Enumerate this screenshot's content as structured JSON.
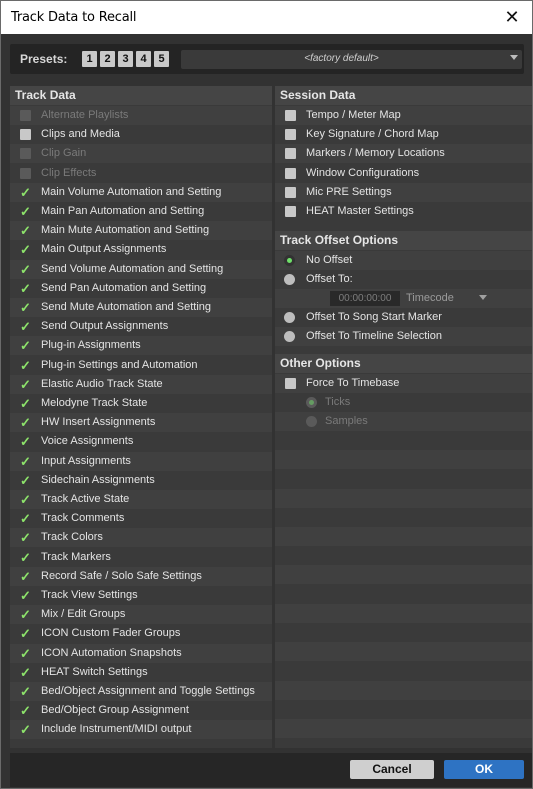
{
  "window": {
    "title": "Track Data to Recall",
    "close_glyph": "✕"
  },
  "presets": {
    "label": "Presets:",
    "buttons": [
      "1",
      "2",
      "3",
      "4",
      "5"
    ],
    "selected": "<factory default>"
  },
  "track_data": {
    "header": "Track Data",
    "items": [
      {
        "label": "Alternate Playlists",
        "state": "disabled"
      },
      {
        "label": "Clips and Media",
        "state": "unchecked"
      },
      {
        "label": "Clip Gain",
        "state": "disabled"
      },
      {
        "label": "Clip Effects",
        "state": "disabled"
      },
      {
        "label": "Main Volume Automation and Setting",
        "state": "checked"
      },
      {
        "label": "Main Pan Automation and Setting",
        "state": "checked"
      },
      {
        "label": "Main Mute Automation and Setting",
        "state": "checked"
      },
      {
        "label": "Main Output Assignments",
        "state": "checked"
      },
      {
        "label": "Send Volume Automation and Setting",
        "state": "checked"
      },
      {
        "label": "Send Pan Automation and Setting",
        "state": "checked"
      },
      {
        "label": "Send Mute Automation and Setting",
        "state": "checked"
      },
      {
        "label": "Send Output Assignments",
        "state": "checked"
      },
      {
        "label": "Plug-in Assignments",
        "state": "checked"
      },
      {
        "label": "Plug-in Settings and Automation",
        "state": "checked"
      },
      {
        "label": "Elastic Audio Track State",
        "state": "checked"
      },
      {
        "label": "Melodyne Track State",
        "state": "checked"
      },
      {
        "label": "HW Insert Assignments",
        "state": "checked"
      },
      {
        "label": "Voice Assignments",
        "state": "checked"
      },
      {
        "label": "Input Assignments",
        "state": "checked"
      },
      {
        "label": "Sidechain Assignments",
        "state": "checked"
      },
      {
        "label": "Track Active State",
        "state": "checked"
      },
      {
        "label": "Track Comments",
        "state": "checked"
      },
      {
        "label": "Track Colors",
        "state": "checked"
      },
      {
        "label": "Track Markers",
        "state": "checked"
      },
      {
        "label": "Record Safe / Solo Safe Settings",
        "state": "checked"
      },
      {
        "label": "Track View Settings",
        "state": "checked"
      },
      {
        "label": "Mix / Edit Groups",
        "state": "checked"
      },
      {
        "label": "ICON Custom Fader Groups",
        "state": "checked"
      },
      {
        "label": "ICON Automation Snapshots",
        "state": "checked"
      },
      {
        "label": "HEAT Switch Settings",
        "state": "checked"
      },
      {
        "label": "Bed/Object Assignment and Toggle Settings",
        "state": "checked"
      },
      {
        "label": "Bed/Object Group Assignment",
        "state": "checked"
      },
      {
        "label": "Include Instrument/MIDI output",
        "state": "checked"
      }
    ]
  },
  "session_data": {
    "header": "Session Data",
    "items": [
      {
        "label": "Tempo / Meter Map",
        "state": "unchecked"
      },
      {
        "label": "Key Signature / Chord Map",
        "state": "unchecked"
      },
      {
        "label": "Markers / Memory Locations",
        "state": "unchecked"
      },
      {
        "label": "Window Configurations",
        "state": "unchecked"
      },
      {
        "label": "Mic PRE Settings",
        "state": "unchecked"
      },
      {
        "label": "HEAT Master Settings",
        "state": "unchecked"
      }
    ]
  },
  "track_offset": {
    "header": "Track Offset Options",
    "no_offset": "No Offset",
    "offset_to": "Offset To:",
    "timecode_value": "00:00:00:00",
    "timecode_format": "Timecode",
    "song_start": "Offset To Song Start Marker",
    "timeline_selection": "Offset To Timeline Selection",
    "selected": "No Offset"
  },
  "other_options": {
    "header": "Other Options",
    "force_timebase": "Force To Timebase",
    "ticks": "Ticks",
    "samples": "Samples",
    "selected_timebase": "Ticks"
  },
  "footer": {
    "cancel": "Cancel",
    "ok": "OK"
  },
  "colors": {
    "check_green": "#8de36b",
    "ok_blue": "#2e73c3",
    "panel_bg": "#3a3a3a"
  }
}
